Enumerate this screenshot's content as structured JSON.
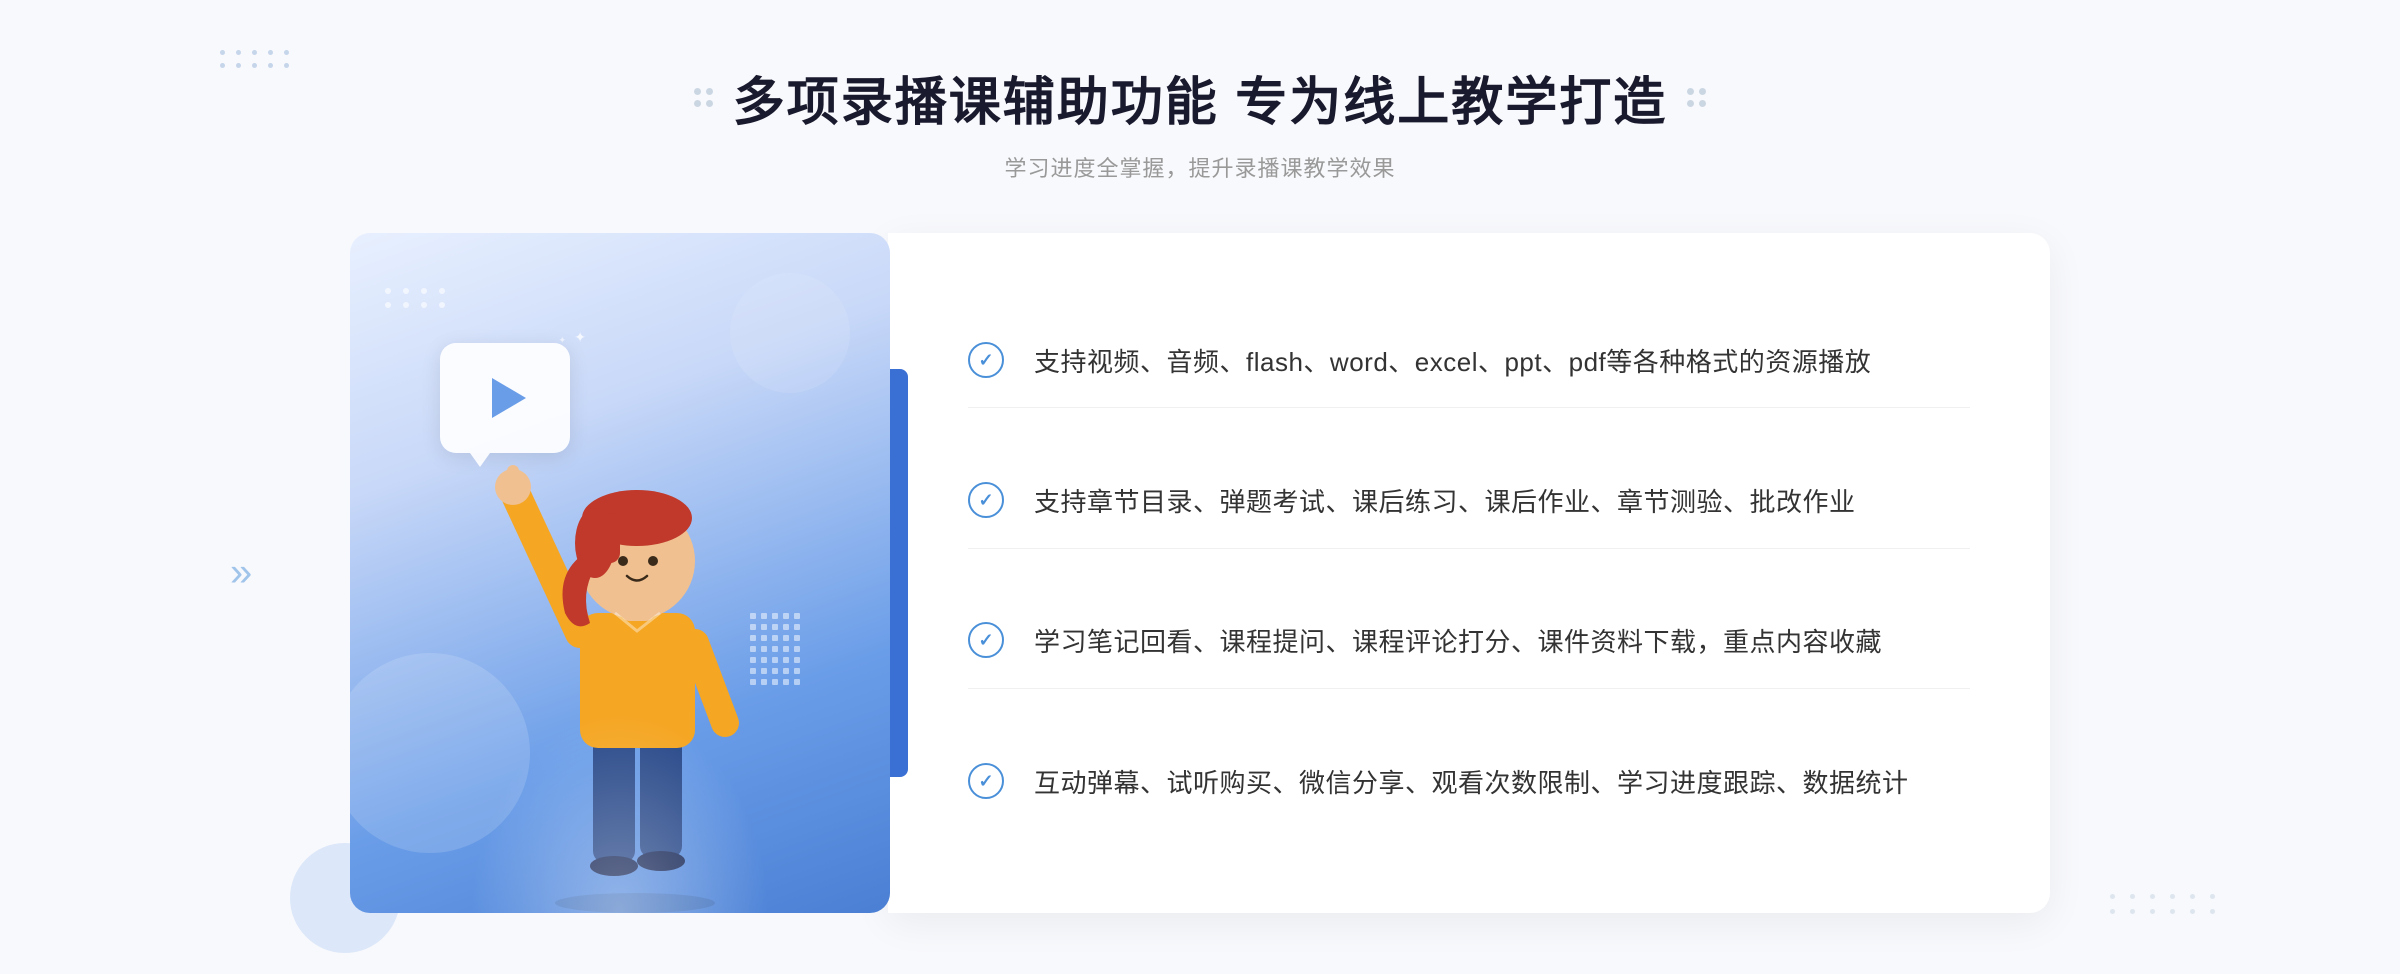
{
  "header": {
    "title": "多项录播课辅助功能 专为线上教学打造",
    "subtitle": "学习进度全掌握，提升录播课教学效果"
  },
  "features": [
    {
      "id": "feature-1",
      "text": "支持视频、音频、flash、word、excel、ppt、pdf等各种格式的资源播放"
    },
    {
      "id": "feature-2",
      "text": "支持章节目录、弹题考试、课后练习、课后作业、章节测验、批改作业"
    },
    {
      "id": "feature-3",
      "text": "学习笔记回看、课程提问、课程评论打分、课件资料下载，重点内容收藏"
    },
    {
      "id": "feature-4",
      "text": "互动弹幕、试听购买、微信分享、观看次数限制、学习进度跟踪、数据统计"
    }
  ],
  "decoration": {
    "chevrons": "»",
    "play_icon": "▶"
  }
}
